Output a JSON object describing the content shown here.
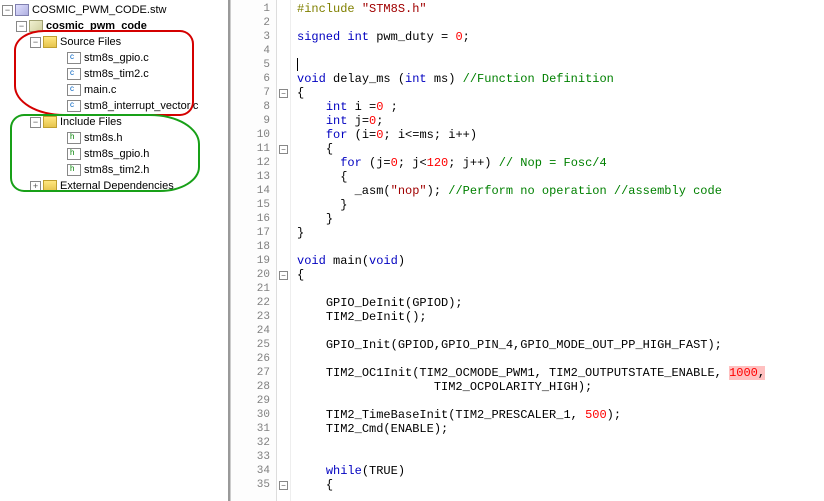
{
  "tree": {
    "workspace": "COSMIC_PWM_CODE.stw",
    "project": "cosmic_pwm_code",
    "source_folder": "Source Files",
    "sources": [
      "stm8s_gpio.c",
      "stm8s_tim2.c",
      "main.c",
      "stm8_interrupt_vector.c"
    ],
    "include_folder": "Include Files",
    "includes": [
      "stm8s.h",
      "stm8s_gpio.h",
      "stm8s_tim2.h"
    ],
    "ext_folder": "External Dependencies"
  },
  "code": {
    "lines": [
      {
        "n": 1,
        "seg": [
          [
            "t-pp",
            "#include "
          ],
          [
            "t-str",
            "\"STM8S.h\""
          ]
        ]
      },
      {
        "n": 2,
        "seg": []
      },
      {
        "n": 3,
        "seg": [
          [
            "t-kw",
            "signed int"
          ],
          [
            "t-fn",
            " pwm_duty = "
          ],
          [
            "t-num",
            "0"
          ],
          [
            "t-fn",
            ";"
          ]
        ]
      },
      {
        "n": 4,
        "seg": []
      },
      {
        "n": 5,
        "caret": true,
        "seg": []
      },
      {
        "n": 6,
        "seg": [
          [
            "t-kw",
            "void"
          ],
          [
            "t-fn",
            " delay_ms ("
          ],
          [
            "t-kw",
            "int"
          ],
          [
            "t-fn",
            " ms) "
          ],
          [
            "t-cmt",
            "//Function Definition"
          ]
        ]
      },
      {
        "n": 7,
        "fold": "-",
        "seg": [
          [
            "t-fn",
            "{"
          ]
        ]
      },
      {
        "n": 8,
        "indent": "    ",
        "seg": [
          [
            "t-kw",
            "int"
          ],
          [
            "t-fn",
            " i ="
          ],
          [
            "t-num",
            "0"
          ],
          [
            "t-fn",
            " ;"
          ]
        ]
      },
      {
        "n": 9,
        "indent": "    ",
        "seg": [
          [
            "t-kw",
            "int"
          ],
          [
            "t-fn",
            " j="
          ],
          [
            "t-num",
            "0"
          ],
          [
            "t-fn",
            ";"
          ]
        ]
      },
      {
        "n": 10,
        "indent": "    ",
        "seg": [
          [
            "t-kw",
            "for"
          ],
          [
            "t-fn",
            " (i="
          ],
          [
            "t-num",
            "0"
          ],
          [
            "t-fn",
            "; i<=ms; i++)"
          ]
        ]
      },
      {
        "n": 11,
        "fold": "-",
        "indent": "    ",
        "seg": [
          [
            "t-fn",
            "{"
          ]
        ]
      },
      {
        "n": 12,
        "indent": "      ",
        "seg": [
          [
            "t-kw",
            "for"
          ],
          [
            "t-fn",
            " (j="
          ],
          [
            "t-num",
            "0"
          ],
          [
            "t-fn",
            "; j<"
          ],
          [
            "t-num",
            "120"
          ],
          [
            "t-fn",
            "; j++) "
          ],
          [
            "t-cmt",
            "// Nop = Fosc/4"
          ]
        ]
      },
      {
        "n": 13,
        "indent": "      ",
        "seg": [
          [
            "t-fn",
            "{"
          ]
        ]
      },
      {
        "n": 14,
        "indent": "        ",
        "seg": [
          [
            "t-fn",
            "_asm("
          ],
          [
            "t-str",
            "\"nop\""
          ],
          [
            "t-fn",
            "); "
          ],
          [
            "t-cmt",
            "//Perform no operation //assembly code"
          ]
        ]
      },
      {
        "n": 15,
        "indent": "      ",
        "seg": [
          [
            "t-fn",
            "}"
          ]
        ]
      },
      {
        "n": 16,
        "indent": "    ",
        "seg": [
          [
            "t-fn",
            "}"
          ]
        ]
      },
      {
        "n": 17,
        "seg": [
          [
            "t-fn",
            "}"
          ]
        ]
      },
      {
        "n": 18,
        "seg": []
      },
      {
        "n": 19,
        "seg": [
          [
            "t-kw",
            "void"
          ],
          [
            "t-fn",
            " main("
          ],
          [
            "t-kw",
            "void"
          ],
          [
            "t-fn",
            ")"
          ]
        ]
      },
      {
        "n": 20,
        "fold": "-",
        "seg": [
          [
            "t-fn",
            "{"
          ]
        ]
      },
      {
        "n": 21,
        "seg": []
      },
      {
        "n": 22,
        "indent": "    ",
        "seg": [
          [
            "t-fn",
            "GPIO_DeInit(GPIOD);"
          ]
        ]
      },
      {
        "n": 23,
        "indent": "    ",
        "seg": [
          [
            "t-fn",
            "TIM2_DeInit();"
          ]
        ]
      },
      {
        "n": 24,
        "seg": []
      },
      {
        "n": 25,
        "indent": "    ",
        "seg": [
          [
            "t-fn",
            "GPIO_Init(GPIOD,GPIO_PIN_4,GPIO_MODE_OUT_PP_HIGH_FAST);"
          ]
        ]
      },
      {
        "n": 26,
        "seg": []
      },
      {
        "n": 27,
        "indent": "    ",
        "seg": [
          [
            "t-fn",
            "TIM2_OC1Init(TIM2_OCMODE_PWM1, TIM2_OUTPUTSTATE_ENABLE, "
          ],
          [
            "t-num hl-err",
            "1000"
          ],
          [
            "t-fn hl-err",
            ","
          ]
        ]
      },
      {
        "n": 28,
        "indent": "                   ",
        "seg": [
          [
            "t-fn",
            "TIM2_OCPOLARITY_HIGH);"
          ]
        ]
      },
      {
        "n": 29,
        "seg": []
      },
      {
        "n": 30,
        "indent": "    ",
        "seg": [
          [
            "t-fn",
            "TIM2_TimeBaseInit(TIM2_PRESCALER_1, "
          ],
          [
            "t-num",
            "500"
          ],
          [
            "t-fn",
            ");"
          ]
        ]
      },
      {
        "n": 31,
        "indent": "    ",
        "seg": [
          [
            "t-fn",
            "TIM2_Cmd(ENABLE);"
          ]
        ]
      },
      {
        "n": 32,
        "seg": []
      },
      {
        "n": 33,
        "seg": []
      },
      {
        "n": 34,
        "indent": "    ",
        "seg": [
          [
            "t-kw",
            "while"
          ],
          [
            "t-fn",
            "(TRUE)"
          ]
        ]
      },
      {
        "n": 35,
        "fold": "-",
        "indent": "    ",
        "seg": [
          [
            "t-fn",
            "{"
          ]
        ]
      }
    ]
  }
}
